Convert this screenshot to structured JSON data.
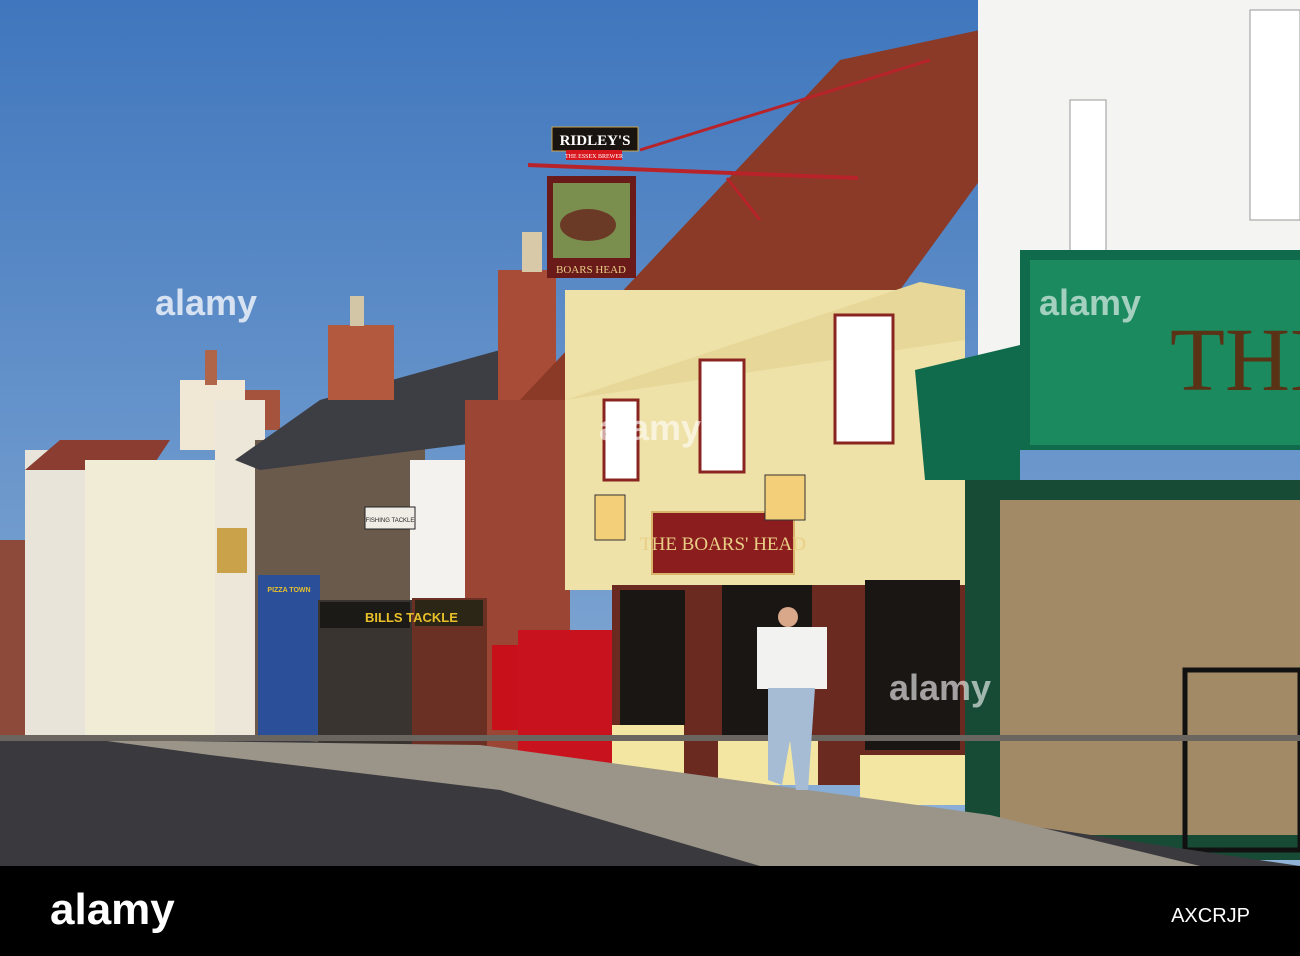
{
  "photo": {
    "signs": {
      "brewery": "RIDLEY'S",
      "brewery_tagline": "THE ESSEX BREWER",
      "hanging_sign": "BOARS HEAD",
      "pub_fascia": "THE BOARS' HEAD",
      "tackle_shop": "BILLS TACKLE",
      "fishing_sign": "FISHING TACKLE",
      "pizza_shop": "PIZZA TOWN",
      "green_shop": "THE"
    },
    "colors": {
      "sky": "#4d84c6",
      "pub_wall": "#efe2a8",
      "roof": "#8a3a26",
      "green_shop": "#0f6b4b",
      "road": "#3a3a3e"
    }
  },
  "watermark": {
    "text": "alamy",
    "footer_logo": "alamy",
    "image_id": "AXCRJP"
  }
}
